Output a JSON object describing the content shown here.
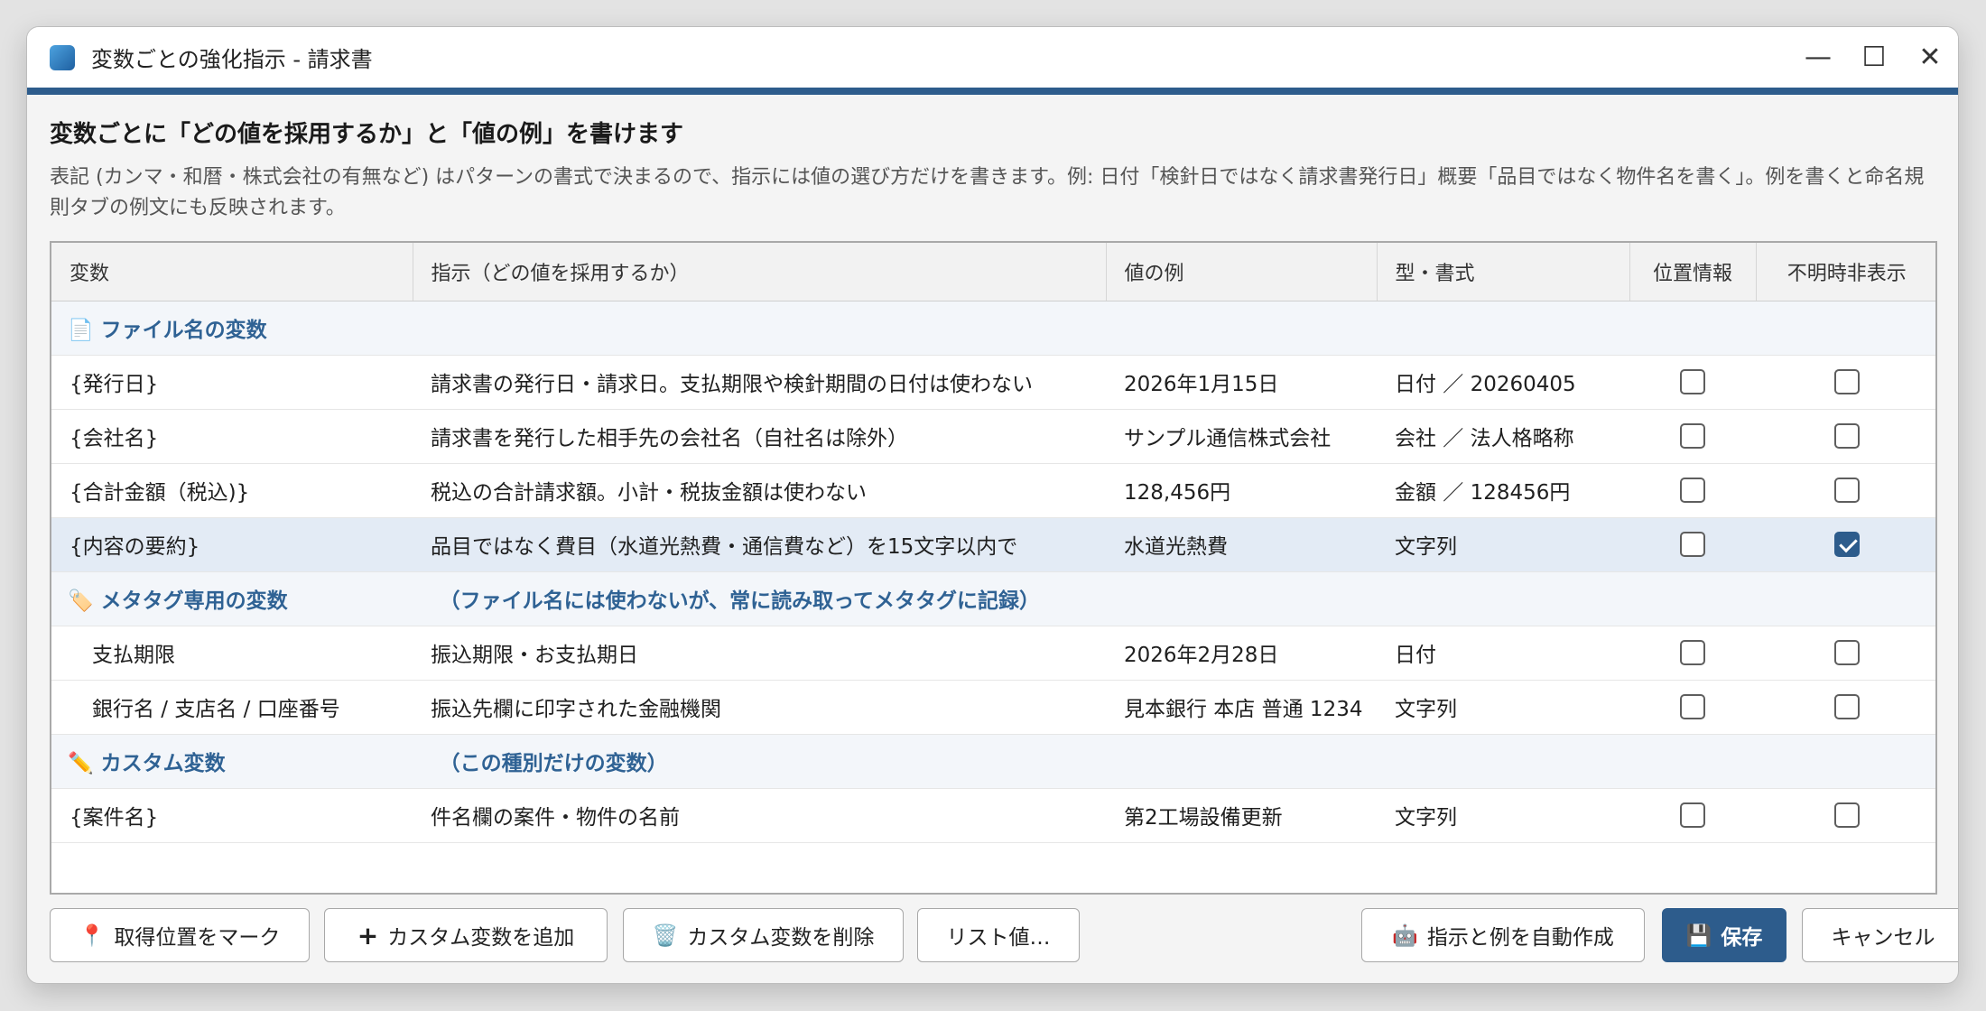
{
  "window": {
    "title": "変数ごとの強化指示 - 請求書",
    "controls": {
      "minimize": "—",
      "maximize": "☐",
      "close": "✕"
    }
  },
  "heading": "変数ごとに「どの値を採用するか」と「値の例」を書けます",
  "description": "表記 (カンマ・和暦・株式会社の有無など) はパターンの書式で決まるので、指示には値の選び方だけを書きます。例: 日付「検針日ではなく請求書発行日」概要「品目ではなく物件名を書く」。例を書くと命名規則タブの例文にも反映されます。",
  "table": {
    "headers": [
      "変数",
      "指示（どの値を採用するか）",
      "値の例",
      "型・書式",
      "位置情報",
      "不明時非表示"
    ],
    "groups": {
      "filename": {
        "icon": "📄",
        "label": "ファイル名の変数"
      },
      "metatag": {
        "icon": "🏷️",
        "label": "メタタグ専用の変数",
        "note": "（ファイル名には使わないが、常に読み取ってメタタグに記録）"
      },
      "custom": {
        "icon": "✏️",
        "label": "カスタム変数",
        "note": "（この種別だけの変数）"
      }
    },
    "rows": [
      {
        "variable": "{発行日}",
        "instruction": "請求書の発行日・請求日。支払期限や検針期間の日付は使わない",
        "example": "2026年1月15日",
        "type": "日付 ／ 20260405",
        "position": false,
        "hide": false
      },
      {
        "variable": "{会社名}",
        "instruction": "請求書を発行した相手先の会社名（自社名は除外）",
        "example": "サンプル通信株式会社",
        "type": "会社 ／ 法人格略称",
        "position": false,
        "hide": false
      },
      {
        "variable": "{合計金額（税込)}",
        "instruction": "税込の合計請求額。小計・税抜金額は使わない",
        "example": "128,456円",
        "type": "金額 ／ 128456円",
        "position": false,
        "hide": false
      },
      {
        "variable": "{内容の要約}",
        "instruction": "品目ではなく費目（水道光熱費・通信費など）を15文字以内で",
        "example": "水道光熱費",
        "type": "文字列",
        "position": false,
        "hide": true
      },
      {
        "variable": "支払期限",
        "instruction": "振込期限・お支払期日",
        "example": "2026年2月28日",
        "type": "日付",
        "position": false,
        "hide": false
      },
      {
        "variable": "銀行名 / 支店名 / 口座番号",
        "instruction": "振込先欄に印字された金融機関",
        "example": "見本銀行 本店 普通 1234",
        "type": "文字列",
        "position": false,
        "hide": false
      },
      {
        "variable": "{案件名}",
        "instruction": "件名欄の案件・物件の名前",
        "example": "第2工場設備更新",
        "type": "文字列",
        "position": false,
        "hide": false
      }
    ]
  },
  "buttons": {
    "mark_position": {
      "icon": "📍",
      "label": "取得位置をマーク"
    },
    "add_custom": {
      "icon": "+",
      "label": "カスタム変数を追加"
    },
    "delete_custom": {
      "icon": "🗑️",
      "label": "カスタム変数を削除"
    },
    "list_values": {
      "label": "リスト値…"
    },
    "auto_create": {
      "icon": "🤖",
      "label": "指示と例を自動作成"
    },
    "save": {
      "icon": "💾",
      "label": "保存"
    },
    "cancel": {
      "label": "キャンセル"
    }
  },
  "colors": {
    "accent": "#2d5c8c",
    "group_text": "#2f6294",
    "selected_row": "#e3ebf5"
  }
}
